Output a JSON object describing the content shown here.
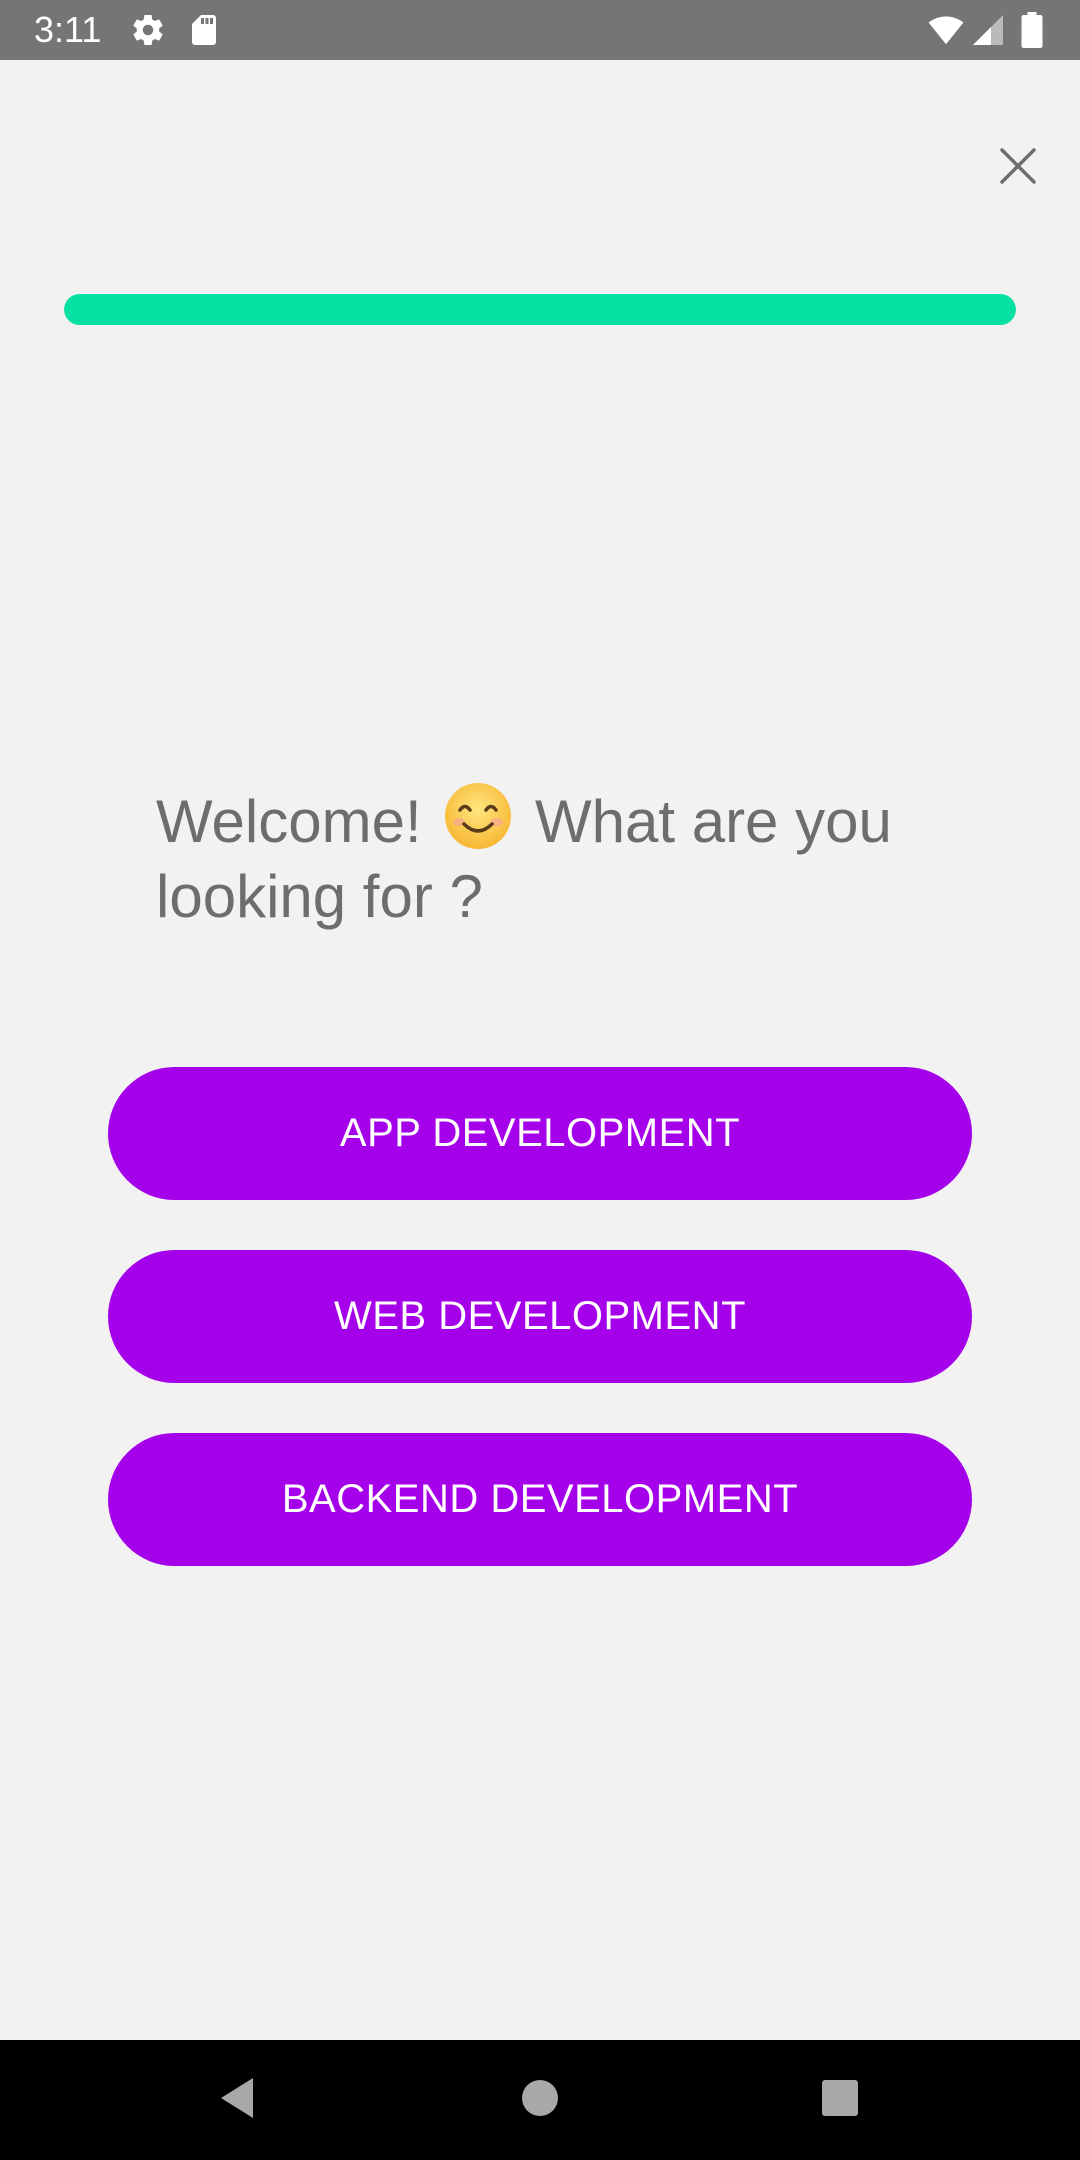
{
  "status_bar": {
    "time": "3:11",
    "left_icons": [
      "gear-icon",
      "sd-card-icon"
    ],
    "right_icons": [
      "wifi-icon",
      "cell-signal-icon",
      "battery-icon"
    ],
    "background": "#757575"
  },
  "progress": {
    "value": 1.0,
    "fill_color": "#06e0a3"
  },
  "heading": {
    "text_before": "Welcome!",
    "emoji": "smiling-face-icon",
    "text_after": "What are you looking for ?"
  },
  "options": [
    {
      "label": "APP DEVELOPMENT"
    },
    {
      "label": "WEB DEVELOPMENT"
    },
    {
      "label": "BACKEND DEVELOPMENT"
    }
  ],
  "colors": {
    "accent": "#a400ea",
    "progress": "#06e0a3",
    "background": "#f2f2f2",
    "heading_text": "#6d6d6d"
  },
  "nav_bar": {
    "buttons": [
      "back-icon",
      "home-icon",
      "recents-icon"
    ]
  }
}
